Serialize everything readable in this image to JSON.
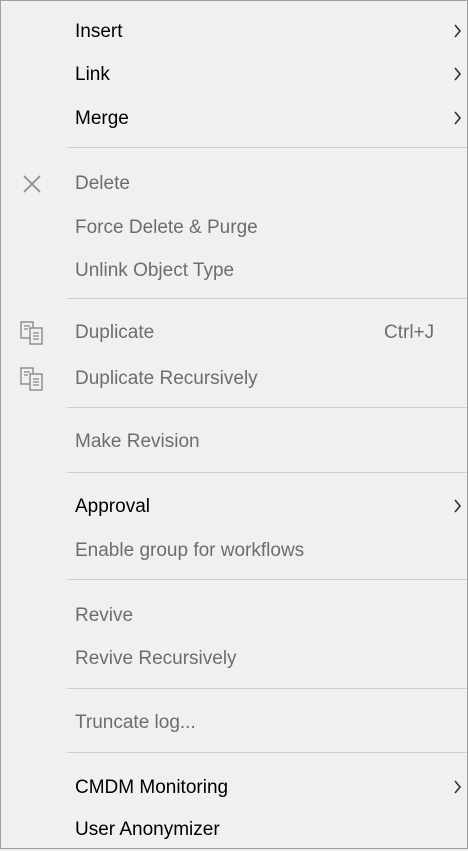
{
  "menu": {
    "items": [
      {
        "label": "Insert",
        "submenu": true
      },
      {
        "label": "Link",
        "submenu": true
      },
      {
        "label": "Merge",
        "submenu": true
      },
      {
        "label": "Delete",
        "icon": "close-x-icon"
      },
      {
        "label": "Force Delete & Purge"
      },
      {
        "label": "Unlink Object Type"
      },
      {
        "label": "Duplicate",
        "shortcut": "Ctrl+J",
        "icon": "duplicate-icon"
      },
      {
        "label": "Duplicate Recursively",
        "icon": "duplicate-icon"
      },
      {
        "label": "Make Revision"
      },
      {
        "label": "Approval",
        "submenu": true
      },
      {
        "label": "Enable group for workflows"
      },
      {
        "label": "Revive"
      },
      {
        "label": "Revive Recursively"
      },
      {
        "label": "Truncate log..."
      },
      {
        "label": "CMDM Monitoring",
        "submenu": true
      },
      {
        "label": "User Anonymizer"
      }
    ]
  },
  "colors": {
    "background": "#f0f0f0",
    "enabled_text": "#000000",
    "disabled_text": "#6d6d6d",
    "separator": "#cfcfcf",
    "border": "#a0a0a0"
  }
}
